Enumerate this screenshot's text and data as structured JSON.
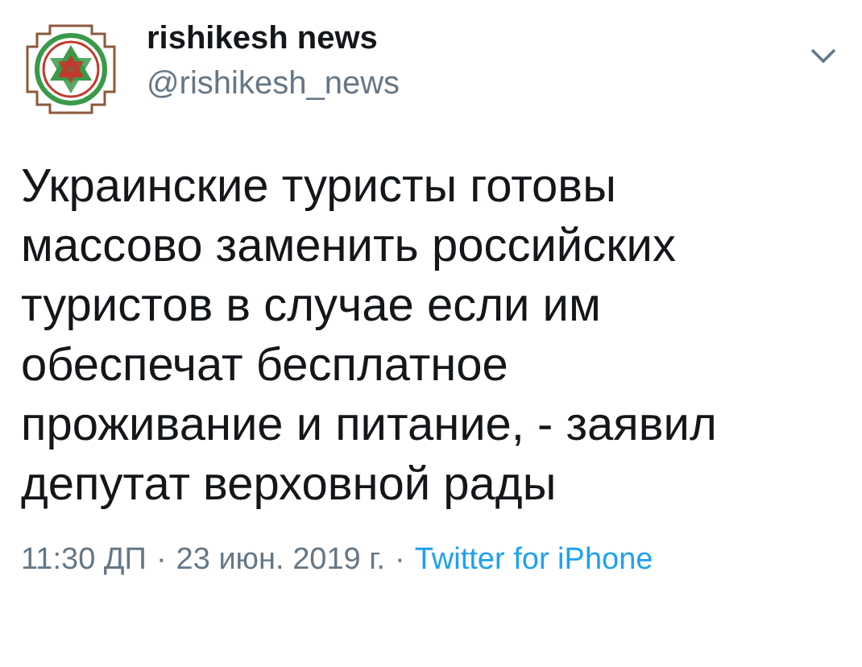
{
  "author": {
    "name": "rishikesh news",
    "handle": "@rishikesh_news"
  },
  "tweet": {
    "lines": [
      "Украинские туристы готовы",
      "массово заменить российских",
      "туристов в случае если им",
      "обеспечат бесплатное",
      "проживание и питание, - заявил",
      "депутат верховной рады"
    ]
  },
  "meta": {
    "time": "11:30 ДП",
    "separator_1": "·",
    "date": "23 июн. 2019 г.",
    "separator_2": "·",
    "source": "Twitter for iPhone"
  }
}
